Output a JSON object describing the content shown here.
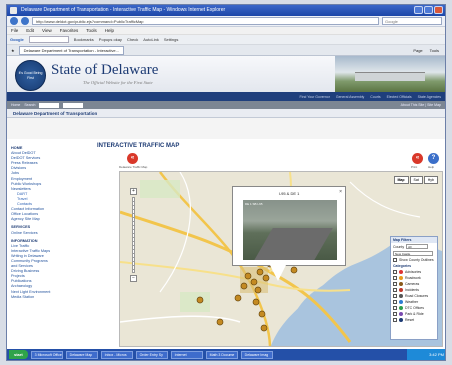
{
  "window": {
    "title": "Delaware Department of Transportation - Interactive Traffic Map - Windows Internet Explorer",
    "url": "http://www.deldot.gov/public.ejs?command=PublicTrafficMap",
    "search_placeholder": "Google"
  },
  "menubar": [
    "File",
    "Edit",
    "View",
    "Favorites",
    "Tools",
    "Help"
  ],
  "toolbar": {
    "google": "Google",
    "bookmarks": "Bookmarks",
    "popups": "Popups okay",
    "check": "Check",
    "autolink": "AutoLink",
    "settings": "Settings"
  },
  "tab": {
    "label": "Delaware Department of Transportation - Interactive...",
    "tools": [
      "Page",
      "Tools"
    ]
  },
  "header": {
    "seal_text": "It's Good Being First",
    "title": "State of Delaware",
    "subtitle": "The Official Website for the First State"
  },
  "blue_strip": [
    "Find Your Governor",
    "General Assembly",
    "Courts",
    "Elected Officials",
    "State Agencies"
  ],
  "gray_strip": {
    "left": [
      "Home",
      "Search"
    ],
    "right": "About This Site | Site Map"
  },
  "department": "Delaware Department of Transportation",
  "leftnav": [
    {
      "type": "hdr",
      "text": "HOME"
    },
    {
      "type": "item",
      "text": "About DelDOT"
    },
    {
      "type": "item",
      "text": "DelDOT Services"
    },
    {
      "type": "item",
      "text": "Press Releases"
    },
    {
      "type": "item",
      "text": "Divisions"
    },
    {
      "type": "item",
      "text": "Jobs"
    },
    {
      "type": "item",
      "text": "Employment"
    },
    {
      "type": "item",
      "text": "Public Workshops"
    },
    {
      "type": "item",
      "text": "Newsletters"
    },
    {
      "type": "sub",
      "text": "DART"
    },
    {
      "type": "sub",
      "text": "Travel"
    },
    {
      "type": "sub",
      "text": "Contacts"
    },
    {
      "type": "item",
      "text": "Contact Information"
    },
    {
      "type": "item",
      "text": "Office Locations"
    },
    {
      "type": "item",
      "text": "Agency Site Map"
    },
    {
      "type": "hdr",
      "text": "SERVICES"
    },
    {
      "type": "item",
      "text": "Online Services"
    },
    {
      "type": "hdr",
      "text": "INFORMATION"
    },
    {
      "type": "item",
      "text": "Live Traffic"
    },
    {
      "type": "item",
      "text": "Interactive Traffic Maps"
    },
    {
      "type": "item",
      "text": "Writing in Delaware"
    },
    {
      "type": "item",
      "text": "Community Programs"
    },
    {
      "type": "item",
      "text": "and Services"
    },
    {
      "type": "item",
      "text": "Driving Business"
    },
    {
      "type": "item",
      "text": "Projects"
    },
    {
      "type": "item",
      "text": "Publications"
    },
    {
      "type": "item",
      "text": "Archaeology"
    },
    {
      "type": "item",
      "text": "Next Light Environment"
    },
    {
      "type": "item",
      "text": "Media Station"
    }
  ],
  "main": {
    "title": "INTERACTIVE TRAFFIC MAP",
    "left_btn_caption": "Delaware Traffic Map",
    "right_caption_1": "Print",
    "right_caption_2": "Help"
  },
  "map": {
    "types": [
      "Map",
      "Sat",
      "Hyb"
    ],
    "popup_title": "I-95 & DE 1",
    "popup_stamp": "DE 1 SB  I-95",
    "close": "×",
    "zoom_plus": "+",
    "zoom_minus": "−"
  },
  "filters": {
    "title": "Map Filters",
    "county_label": "County",
    "county_value": "All",
    "county_select": "New Castle",
    "show_all": "Show County Outlines",
    "categories_label": "Categories",
    "categories": [
      {
        "label": "Advisories",
        "color": "#d33"
      },
      {
        "label": "Roadwork",
        "color": "#e89a1c"
      },
      {
        "label": "Cameras",
        "color": "#8a5a1a"
      },
      {
        "label": "Incidents",
        "color": "#c0392b"
      },
      {
        "label": "Road Closures",
        "color": "#555"
      },
      {
        "label": "Weather",
        "color": "#2d7dd2"
      },
      {
        "label": "DTC Offices",
        "color": "#2c9e4b"
      },
      {
        "label": "Park & Ride",
        "color": "#7a4ab0"
      },
      {
        "label": "Reset",
        "color": "#1d3b74"
      }
    ]
  },
  "taskbar": {
    "start": "start",
    "tasks": [
      "3 Microsoft Office",
      "Delaware Map",
      "Inbox - Micros",
      "Order Entry Sy",
      "Internet",
      "Math 3 Docume",
      "Delaware Imag"
    ],
    "clock": "3:42 PM"
  }
}
